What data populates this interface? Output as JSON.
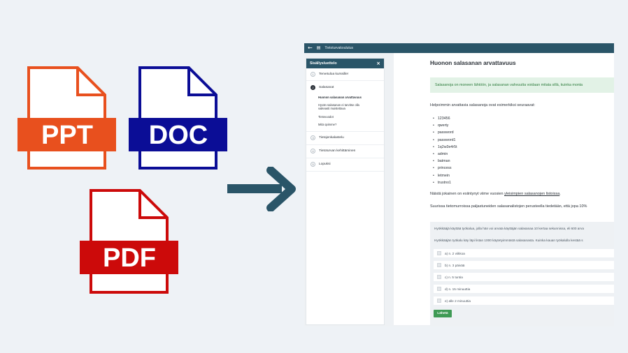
{
  "file_icons": {
    "ppt": {
      "label": "PPT",
      "color": "#e8501e"
    },
    "doc": {
      "label": "DOC",
      "color": "#0b0d96"
    },
    "pdf": {
      "label": "PDF",
      "color": "#cc0a0a"
    }
  },
  "arrow": {
    "icon": "right-arrow-icon",
    "color": "#2a5568"
  },
  "app": {
    "topbar": {
      "back_icon": "←",
      "menu_icon": "▤",
      "title": "Tietoturvakoulutus"
    },
    "sidebar": {
      "title": "Sisällysluettelo",
      "close": "×",
      "items": [
        {
          "num": "1",
          "label": "Tervetuloa kurssille!"
        },
        {
          "num": "2",
          "label": "Salasanat"
        },
        {
          "num": "3",
          "label": "Tietojenkalastelu"
        },
        {
          "num": "4",
          "label": "Tietoturvan kehittäminen"
        },
        {
          "num": "5",
          "label": "Lopuksi"
        }
      ],
      "subitems": [
        {
          "label": "Huonon salasanan arvattavuus"
        },
        {
          "label": "Hyvän salasanan ei tarvitse olla"
        },
        {
          "label": "vaikeasti muistettava"
        },
        {
          "label": "Tietovuodot"
        },
        {
          "label": "Mitä opimme?"
        }
      ]
    },
    "content": {
      "title": "Huonon salasanan arvattavuus",
      "notice": "Salasanoja on moneen lähtöön, ja salasanan vahvuutta voidaan mitata sillä, kuinka monta",
      "intro": "Helpoimmin arvattavia salasanoja ovat esimerkiksi seuraavat:",
      "passwords": [
        "123456",
        "qwerty",
        "password",
        "password1",
        "1q2w3e4r5t",
        "admin",
        "batman",
        "princess",
        "letmein",
        "trustno1"
      ],
      "leak_text_before": "Näistä jokainen on esiintynyt viime vuosien ",
      "leak_link": "yleisimpien salasanojen listoissa",
      "leak_text_after": ".",
      "breach_text": "Suurissa tietomurroissa paljastuneiden salasanalistojen perusteella tiedetään, että jopa 10%",
      "quiz": {
        "intro": "Hyökkääjä käyttää työkalua, jolla hän voi arvata käyttäjän salasanaa 10 kertaa sekunnissa, eli 600 arva",
        "question": "Hyökkääjän työkalu käy läpi listan 1000 käytetyimmästä salasanasta. Kuinka kauan työkalulla kestää s",
        "options": [
          {
            "label": "a) n. 2 viikkoa"
          },
          {
            "label": "b) n. 3 päivää"
          },
          {
            "label": "c) n. 5 tuntia"
          },
          {
            "label": "d) n. 15 minuuttia"
          },
          {
            "label": "e) alle 2 minuuttia"
          }
        ],
        "submit": "Lähetä"
      }
    }
  }
}
